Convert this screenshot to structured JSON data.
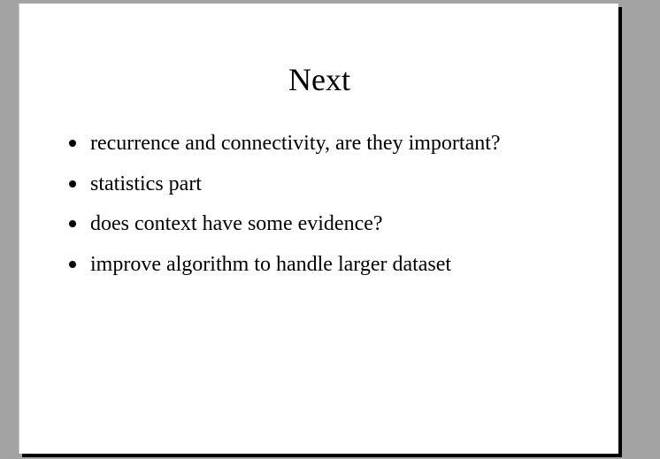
{
  "slide": {
    "title": "Next",
    "bullets": [
      "recurrence and connectivity, are they important?",
      "statistics part",
      "does context have some evidence?",
      "improve algorithm to handle larger dataset"
    ]
  }
}
